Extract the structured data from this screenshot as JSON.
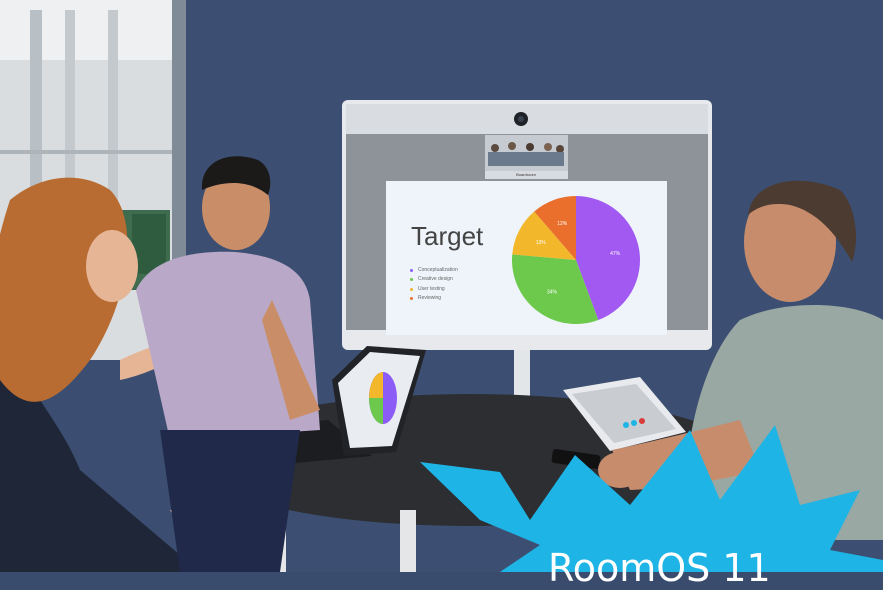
{
  "slide": {
    "title": "Target",
    "legend": [
      {
        "label": "Conceptualization",
        "color": "#8b5cf6"
      },
      {
        "label": "Creative design",
        "color": "#6cc54a"
      },
      {
        "label": "User testing",
        "color": "#f0b429"
      },
      {
        "label": "Reviewing",
        "color": "#e8722f"
      }
    ]
  },
  "chart_data": {
    "type": "pie",
    "slices": [
      {
        "label": "47%",
        "value": 47,
        "color": "#a259f2"
      },
      {
        "label": "34%",
        "value": 34,
        "color": "#6cc94c"
      },
      {
        "label": "13%",
        "value": 13,
        "color": "#f2b72a"
      },
      {
        "label": "12%",
        "value": 12,
        "color": "#ea6f2d"
      }
    ]
  },
  "camera_view": {
    "label": "Boardroom"
  },
  "overlay": {
    "text": "RoomOS 11",
    "burst_color": "#1eb4e6"
  },
  "colors": {
    "wall": "#3a4c6e",
    "table": "#2b2d30",
    "screen_frame": "#e7e9ec"
  }
}
